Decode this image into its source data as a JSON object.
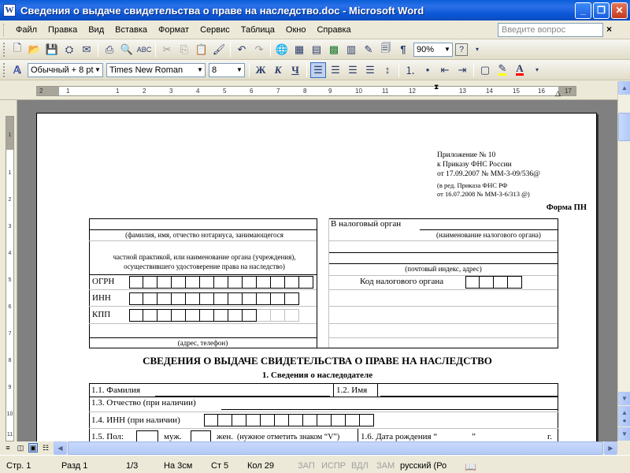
{
  "window": {
    "title": "Сведения о выдаче свидетельства о праве на наследство.doc - Microsoft Word",
    "app_icon": "W",
    "min": "_",
    "max": "❐",
    "close": "✕"
  },
  "menu": {
    "items": [
      "Файл",
      "Правка",
      "Вид",
      "Вставка",
      "Формат",
      "Сервис",
      "Таблица",
      "Окно",
      "Справка"
    ],
    "help_placeholder": "Введите вопрос",
    "help_close": "×"
  },
  "toolbar_standard": {
    "icons": [
      "new-icon",
      "open-icon",
      "save-icon",
      "permission-icon",
      "email-icon",
      "print-icon",
      "print-preview-icon",
      "spelling-icon",
      "cut-icon",
      "copy-icon",
      "paste-icon",
      "format-painter-icon",
      "undo-icon",
      "redo-icon",
      "hyperlink-icon",
      "tables-borders-icon",
      "insert-table-icon",
      "insert-excel-icon",
      "columns-icon",
      "drawing-icon",
      "document-map-icon",
      "show-formatting-icon"
    ],
    "zoom": "90%",
    "help_icon": "?"
  },
  "toolbar_formatting": {
    "style": "Обычный + 8 pt",
    "font": "Times New Roman",
    "size": "8",
    "bold": "Ж",
    "italic": "К",
    "underline": "Ч",
    "highlight_color": "#ffff00",
    "font_color": "#ff0000"
  },
  "ruler": {
    "h_labels": [
      "2",
      "1",
      "1",
      "2",
      "3",
      "4",
      "5",
      "6",
      "7",
      "8",
      "9",
      "10",
      "11",
      "12",
      "13",
      "14",
      "15",
      "16",
      "17",
      "18"
    ],
    "v_labels": [
      "1",
      "1",
      "2",
      "3",
      "4",
      "5",
      "6",
      "7",
      "8",
      "9",
      "10",
      "11"
    ]
  },
  "document": {
    "appendix": {
      "line1": "Приложение № 10",
      "line2": "к Приказу ФНС России",
      "line3": "от 17.09.2007 № ММ-3-09/536@",
      "line4": "(в ред. Приказа ФНС РФ",
      "line5": "от 16.07.2008 № ММ-3-6/313 @)"
    },
    "form_label": "Форма ПН",
    "tax_authority_label": "В налоговый орган",
    "caption_notary": "(фамилия, имя, отчество нотариуса, занимающегося",
    "caption_tax_name": "(наименование налогового органа)",
    "caption_notary2": "частной практикой, или наименование органа (учреждения),",
    "caption_notary3": "осуществившего удостоверение права на наследство)",
    "caption_postal": "(почтовый индекс, адрес)",
    "ogrn": "ОГРН",
    "inn": "ИНН",
    "kpp": "КПП",
    "tax_code_label": "Код налогового органа",
    "caption_address": "(адрес, телефон)",
    "main_title": "СВЕДЕНИЯ О ВЫДАЧЕ СВИДЕТЕЛЬСТВА О ПРАВЕ НА НАСЛЕДСТВО",
    "section1": "1. Сведения о наследодателе",
    "f11": "1.1. Фамилия",
    "f12": "1.2. Имя",
    "f13": "1.3. Отчество (при наличии)",
    "f14": "1.4. ИНН (при наличии)",
    "f15": "1.5. Пол:",
    "male": "муж.",
    "female": "жен.",
    "sex_note": "(нужное отметить знаком “V”)",
    "f16": "1.6. Дата рождения “",
    "quote_close": "”",
    "year_abbr": "г."
  },
  "status": {
    "page": "Стр. 1",
    "section": "Разд 1",
    "pages": "1/3",
    "at": "На 3см",
    "line": "Ст 5",
    "col": "Кол 29",
    "rec": "ЗАП",
    "trk": "ИСПР",
    "ext": "ВДЛ",
    "ovr": "ЗАМ",
    "language": "русский (Ро"
  }
}
